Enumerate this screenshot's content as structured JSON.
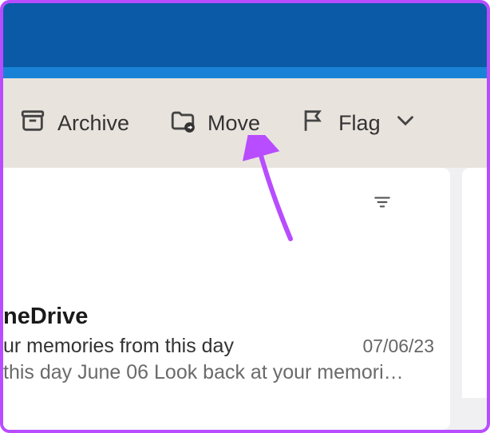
{
  "toolbar": {
    "archive_label": "Archive",
    "move_label": "Move",
    "flag_label": "Flag"
  },
  "message": {
    "sender": "neDrive",
    "subject": "ur memories from this day",
    "date": "07/06/23",
    "preview": " this day June 06 Look back at your memori…"
  }
}
